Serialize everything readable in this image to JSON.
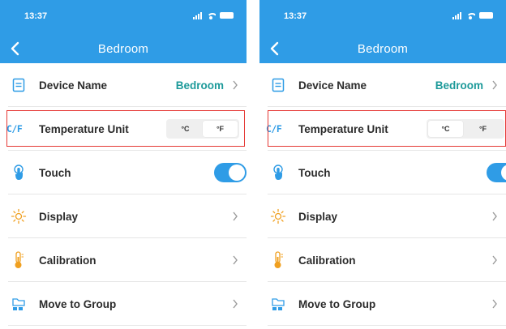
{
  "status_bar": {
    "time": "13:37"
  },
  "header": {
    "title": "Bedroom"
  },
  "settings": {
    "device_name": {
      "label": "Device Name",
      "value": "Bedroom"
    },
    "temperature_unit": {
      "label": "Temperature Unit",
      "icon_text": "C/F",
      "options": [
        "°C",
        "°F"
      ],
      "selected": "°F"
    },
    "touch": {
      "label": "Touch",
      "enabled": true
    },
    "display": {
      "label": "Display"
    },
    "calibration": {
      "label": "Calibration"
    },
    "move_to_group": {
      "label": "Move to Group"
    }
  },
  "colors": {
    "header": "#2f9ce6",
    "accent_value": "#1d9a9a",
    "highlight": "#e53935"
  }
}
